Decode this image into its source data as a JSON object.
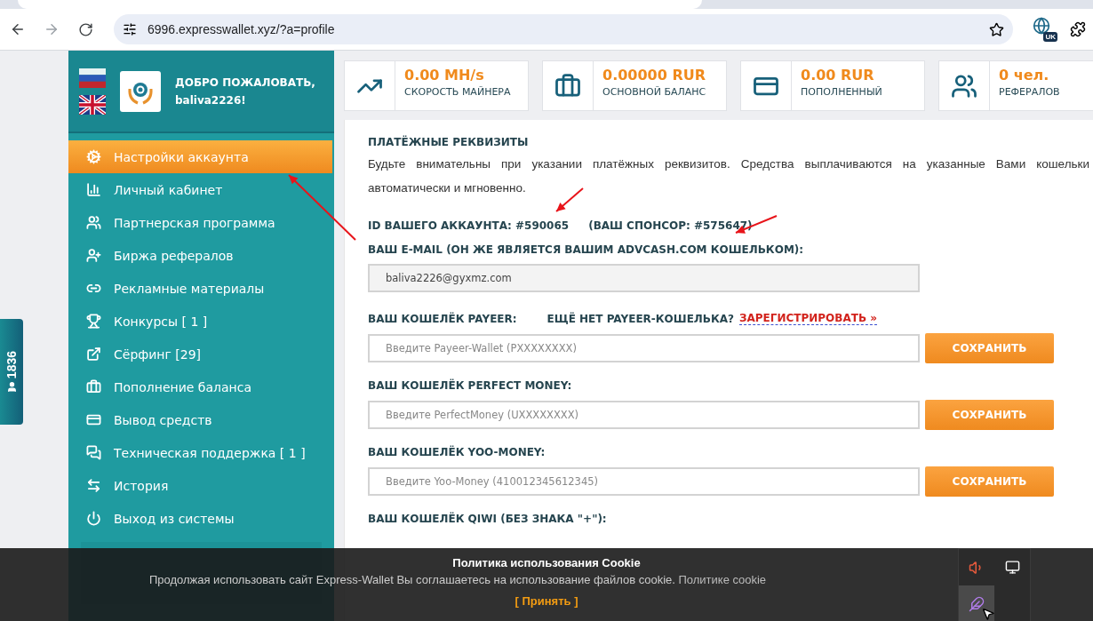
{
  "browser": {
    "url": "6996.expresswallet.xyz/?a=profile",
    "extension_badge": "UK"
  },
  "sidebar": {
    "welcome": "ДОБРО ПОЖАЛОВАТЬ,",
    "username": "baliva2226!",
    "menu": [
      {
        "label": "Настройки аккаунта",
        "selected": true
      },
      {
        "label": "Личный кабинет",
        "selected": false
      },
      {
        "label": "Партнерская программа",
        "selected": false
      },
      {
        "label": "Биржа рефералов",
        "selected": false
      },
      {
        "label": "Рекламные материалы",
        "selected": false
      },
      {
        "label": "Конкурсы [ 1 ]",
        "selected": false
      },
      {
        "label": "Сёрфинг [29]",
        "selected": false
      },
      {
        "label": "Пополнение баланса",
        "selected": false
      },
      {
        "label": "Вывод средств",
        "selected": false
      },
      {
        "label": "Техническая поддержка [ 1 ]",
        "selected": false
      },
      {
        "label": "История",
        "selected": false
      },
      {
        "label": "Выход из системы",
        "selected": false
      }
    ]
  },
  "online_badge": "1836",
  "stats": [
    {
      "value": "0.00 MH/s",
      "label": "СКОРОСТЬ МАЙНЕРА"
    },
    {
      "value": "0.00000 RUR",
      "label": "ОСНОВНОЙ БАЛАНС"
    },
    {
      "value": "0.00 RUR",
      "label": "ПОПОЛНЕННЫЙ"
    },
    {
      "value": "0 чел.",
      "label": "РЕФЕРАЛОВ"
    }
  ],
  "profile": {
    "title": "ПЛАТЁЖНЫЕ РЕКВИЗИТЫ",
    "notice": "Будьте внимательны при указании платёжных реквизитов. Средства выплачиваются на указанные Вами кошельки автоматически и мгновенно.",
    "account_id": "ID ВАШЕГО АККАУНТА: #590065",
    "sponsor": "(ВАШ СПОНСОР: #575647)",
    "email_label": "ВАШ E-MAIL (ОН ЖЕ ЯВЛЯЕТСЯ ВАШИМ ADVCASH.COM КОШЕЛЬКОМ):",
    "email_value": "baliva2226@gyxmz.com",
    "wallets": [
      {
        "label": "ВАШ КОШЕЛЁК PAYEER:",
        "hint": "ЕЩЁ НЕТ PAYEER-КОШЕЛЬКА?",
        "link": "ЗАРЕГИСТРИРОВАТЬ »",
        "placeholder": "Введите Payeer-Wallet (PXXXXXXXX)",
        "button": "СОХРАНИТЬ"
      },
      {
        "label": "ВАШ КОШЕЛЁК PERFECT MONEY:",
        "placeholder": "Введите PerfectMoney (UXXXXXXXX)",
        "button": "СОХРАНИТЬ"
      },
      {
        "label": "ВАШ КОШЕЛЁК YOO-MONEY:",
        "placeholder": "Введите Yoo-Money (410012345612345)",
        "button": "СОХРАНИТЬ"
      },
      {
        "label": "ВАШ КОШЕЛЁК QIWI (БЕЗ ЗНАКА \"+\"):"
      }
    ]
  },
  "cookie": {
    "title": "Политика использования Cookie",
    "text": "Продолжая использовать сайт Express-Wallet Вы соглашаетесь на использование файлов cookie.",
    "link": "Политике cookie",
    "accept": "[ Принять ]"
  }
}
